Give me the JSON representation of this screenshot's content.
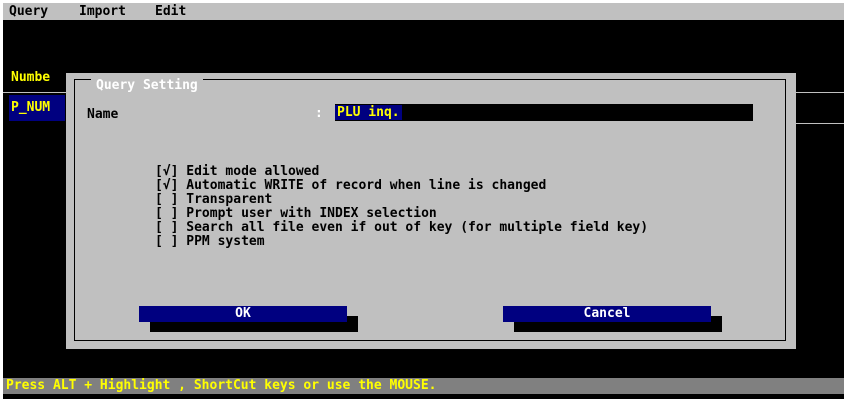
{
  "menu": {
    "items": [
      "Query",
      "Import",
      "Edit"
    ]
  },
  "background": {
    "number_label": "Numbe",
    "p_num_label": "P_NUM"
  },
  "dialog": {
    "title": "Query Setting",
    "name_label": "Name",
    "name_colon": ":",
    "name_value": "PLU inq.",
    "options": [
      {
        "mark": "[√]",
        "label": "Edit mode allowed",
        "checked": true
      },
      {
        "mark": "[√]",
        "label": "Automatic WRITE of record when line is changed",
        "checked": true
      },
      {
        "mark": "[ ]",
        "label": "Transparent",
        "checked": false
      },
      {
        "mark": "[ ]",
        "label": "Prompt user with INDEX selection",
        "checked": false
      },
      {
        "mark": "[ ]",
        "label": "Search all file even if out of key (for multiple field key)",
        "checked": false
      },
      {
        "mark": "[ ]",
        "label": "PPM system",
        "checked": false
      }
    ],
    "ok_label": "OK",
    "cancel_label": "Cancel"
  },
  "status": {
    "text": "Press ALT + Highlight , ShortCut keys or use the MOUSE."
  },
  "colors": {
    "menubar": "#c0c0c0",
    "dialog": "#c0c0c0",
    "button": "#000080",
    "highlight": "#ffff00",
    "status": "#808080"
  }
}
